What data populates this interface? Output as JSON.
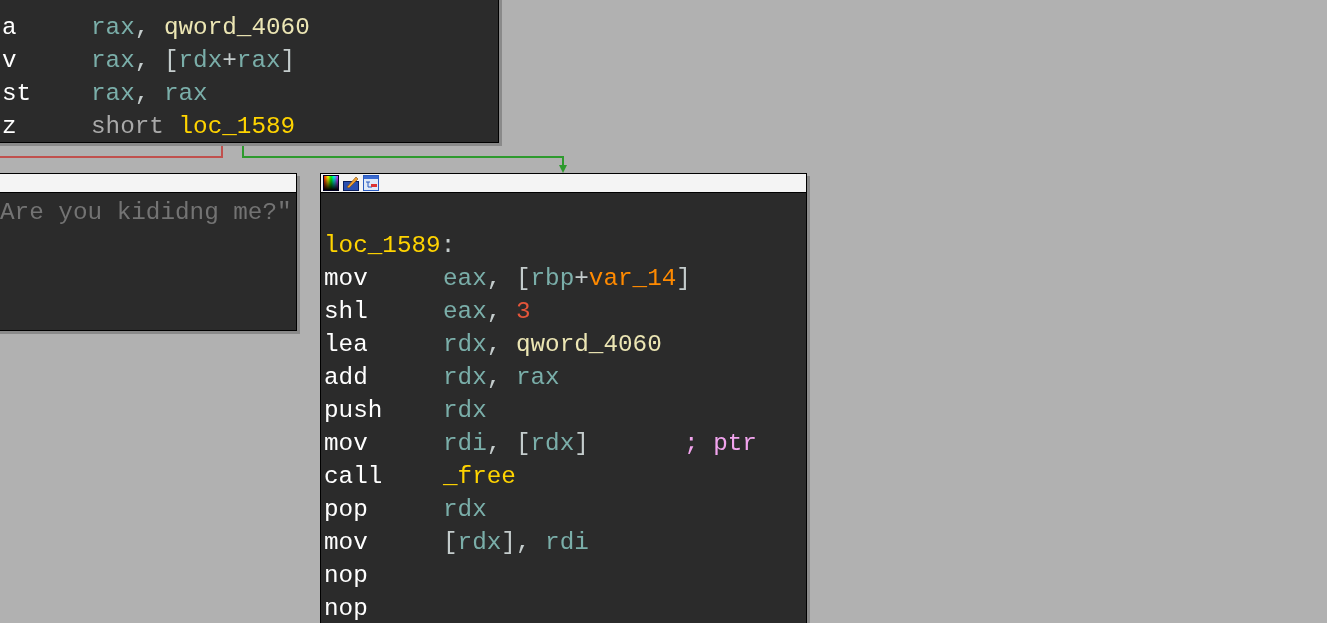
{
  "blocks": [
    {
      "kind": "top",
      "header": false,
      "lines": [
        {
          "mnemonic": "a",
          "operands": [
            {
              "text": "rax",
              "kind": "register"
            },
            {
              "text": ", ",
              "kind": "punct"
            },
            {
              "text": "qword_4060",
              "kind": "name"
            }
          ]
        },
        {
          "mnemonic": "v",
          "operands": [
            {
              "text": "rax",
              "kind": "register"
            },
            {
              "text": ", [",
              "kind": "punct"
            },
            {
              "text": "rdx",
              "kind": "register"
            },
            {
              "text": "+",
              "kind": "punct"
            },
            {
              "text": "rax",
              "kind": "register"
            },
            {
              "text": "]",
              "kind": "punct"
            }
          ]
        },
        {
          "mnemonic": "st",
          "operands": [
            {
              "text": "rax",
              "kind": "register"
            },
            {
              "text": ", ",
              "kind": "punct"
            },
            {
              "text": "rax",
              "kind": "register"
            }
          ]
        },
        {
          "mnemonic": "z",
          "operands": [
            {
              "text": "short ",
              "kind": "keyword"
            },
            {
              "text": "loc_1589",
              "kind": "label"
            }
          ]
        }
      ]
    },
    {
      "kind": "side",
      "header": true,
      "lines": [
        {
          "operands": [
            {
              "text": "Are you kididng me?\"",
              "kind": "string"
            }
          ]
        }
      ]
    },
    {
      "kind": "main",
      "header": true,
      "lines": [
        {
          "label": [
            {
              "text": "loc_1589",
              "kind": "label"
            },
            {
              "text": ":",
              "kind": "punct"
            }
          ]
        },
        {
          "mnemonic": "mov",
          "operands": [
            {
              "text": "eax",
              "kind": "register"
            },
            {
              "text": ", [",
              "kind": "punct"
            },
            {
              "text": "rbp",
              "kind": "register"
            },
            {
              "text": "+",
              "kind": "punct"
            },
            {
              "text": "var_14",
              "kind": "var"
            },
            {
              "text": "]",
              "kind": "punct"
            }
          ]
        },
        {
          "mnemonic": "shl",
          "operands": [
            {
              "text": "eax",
              "kind": "register"
            },
            {
              "text": ", ",
              "kind": "punct"
            },
            {
              "text": "3",
              "kind": "number"
            }
          ]
        },
        {
          "mnemonic": "lea",
          "operands": [
            {
              "text": "rdx",
              "kind": "register"
            },
            {
              "text": ", ",
              "kind": "punct"
            },
            {
              "text": "qword_4060",
              "kind": "name"
            }
          ]
        },
        {
          "mnemonic": "add",
          "operands": [
            {
              "text": "rdx",
              "kind": "register"
            },
            {
              "text": ", ",
              "kind": "punct"
            },
            {
              "text": "rax",
              "kind": "register"
            }
          ]
        },
        {
          "mnemonic": "push",
          "operands": [
            {
              "text": "rdx",
              "kind": "register"
            }
          ]
        },
        {
          "mnemonic": "mov",
          "operands": [
            {
              "text": "rdi",
              "kind": "register"
            },
            {
              "text": ", [",
              "kind": "punct"
            },
            {
              "text": "rdx",
              "kind": "register"
            },
            {
              "text": "]",
              "kind": "punct"
            }
          ],
          "comment": "; ptr"
        },
        {
          "mnemonic": "call",
          "operands": [
            {
              "text": "_free",
              "kind": "label"
            }
          ]
        },
        {
          "mnemonic": "pop",
          "operands": [
            {
              "text": "rdx",
              "kind": "register"
            }
          ]
        },
        {
          "mnemonic": "mov",
          "operands": [
            {
              "text": "[",
              "kind": "punct"
            },
            {
              "text": "rdx",
              "kind": "register"
            },
            {
              "text": "], ",
              "kind": "punct"
            },
            {
              "text": "rdi",
              "kind": "register"
            }
          ]
        },
        {
          "mnemonic": "nop"
        },
        {
          "mnemonic": "nop"
        }
      ]
    }
  ],
  "edges": [
    {
      "color": "#c0504d"
    },
    {
      "color": "#2e9a2e"
    }
  ]
}
